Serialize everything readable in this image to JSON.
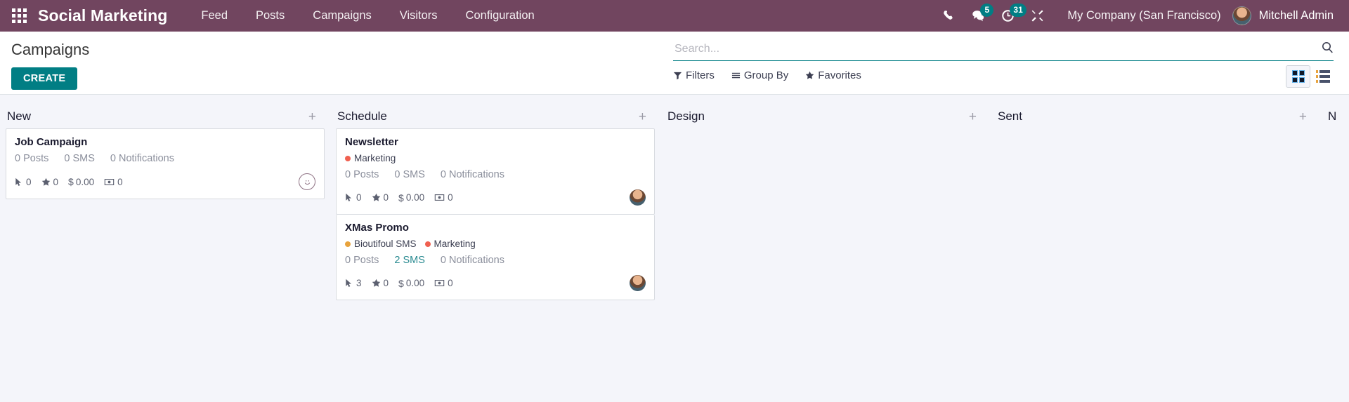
{
  "navbar": {
    "apps_icon": "grid-apps-icon",
    "brand": "Social Marketing",
    "menu": [
      {
        "label": "Feed"
      },
      {
        "label": "Posts"
      },
      {
        "label": "Campaigns"
      },
      {
        "label": "Visitors"
      },
      {
        "label": "Configuration"
      }
    ],
    "icons": {
      "phone": "phone-icon",
      "messages": "chat-bubble-icon",
      "messages_count": "5",
      "activities": "clock-icon",
      "activities_count": "31",
      "debug": "wrench-tools-icon"
    },
    "company": "My Company (San Francisco)",
    "user": "Mitchell Admin",
    "avatar": "user-avatar"
  },
  "control_panel": {
    "title": "Campaigns",
    "create_label": "CREATE",
    "search": {
      "placeholder": "Search...",
      "value": "",
      "icon": "search-icon"
    },
    "filters": [
      {
        "label": "Filters",
        "icon": "funnel-icon"
      },
      {
        "label": "Group By",
        "icon": "list-lines-icon"
      },
      {
        "label": "Favorites",
        "icon": "star-icon"
      }
    ],
    "views": [
      {
        "name": "kanban",
        "icon": "kanban-view-icon",
        "active": true
      },
      {
        "name": "list",
        "icon": "list-view-icon",
        "active": false
      }
    ]
  },
  "kanban": {
    "add_symbol": "+",
    "columns": [
      {
        "title": "New",
        "cards": [
          {
            "title": "Job Campaign",
            "tags": [],
            "counters": [
              {
                "label": "0 Posts",
                "link": false
              },
              {
                "label": "0 SMS",
                "link": false
              },
              {
                "label": "0 Notifications",
                "link": false
              }
            ],
            "stats": [
              {
                "icon": "mouse-pointer-icon",
                "value": "0"
              },
              {
                "icon": "star-icon",
                "value": "0"
              },
              {
                "icon": "dollar-icon",
                "value": "0.00"
              },
              {
                "icon": "banknote-icon",
                "value": "0"
              }
            ],
            "avatar_type": "smiley"
          }
        ]
      },
      {
        "title": "Schedule",
        "cards": [
          {
            "title": "Newsletter",
            "tags": [
              {
                "label": "Marketing",
                "color": "#F06050"
              }
            ],
            "counters": [
              {
                "label": "0 Posts",
                "link": false
              },
              {
                "label": "0 SMS",
                "link": false
              },
              {
                "label": "0 Notifications",
                "link": false
              }
            ],
            "stats": [
              {
                "icon": "mouse-pointer-icon",
                "value": "0"
              },
              {
                "icon": "star-icon",
                "value": "0"
              },
              {
                "icon": "dollar-icon",
                "value": "0.00"
              },
              {
                "icon": "banknote-icon",
                "value": "0"
              }
            ],
            "avatar_type": "photo"
          },
          {
            "title": "XMas Promo",
            "tags": [
              {
                "label": "Bioutifoul SMS",
                "color": "#E8A33D"
              },
              {
                "label": "Marketing",
                "color": "#F06050"
              }
            ],
            "counters": [
              {
                "label": "0 Posts",
                "link": false
              },
              {
                "label": "2 SMS",
                "link": true
              },
              {
                "label": "0 Notifications",
                "link": false
              }
            ],
            "stats": [
              {
                "icon": "mouse-pointer-icon",
                "value": "3"
              },
              {
                "icon": "star-icon",
                "value": "0"
              },
              {
                "icon": "dollar-icon",
                "value": "0.00"
              },
              {
                "icon": "banknote-icon",
                "value": "0"
              }
            ],
            "avatar_type": "photo"
          }
        ]
      },
      {
        "title": "Design",
        "cards": []
      },
      {
        "title": "Sent",
        "cards": []
      }
    ],
    "partial_column": {
      "title": "N"
    }
  },
  "colors": {
    "navbar": "#71455F",
    "accent": "#017E84",
    "link": "#2C8C92",
    "kanban_bg": "#F4F5FA"
  }
}
